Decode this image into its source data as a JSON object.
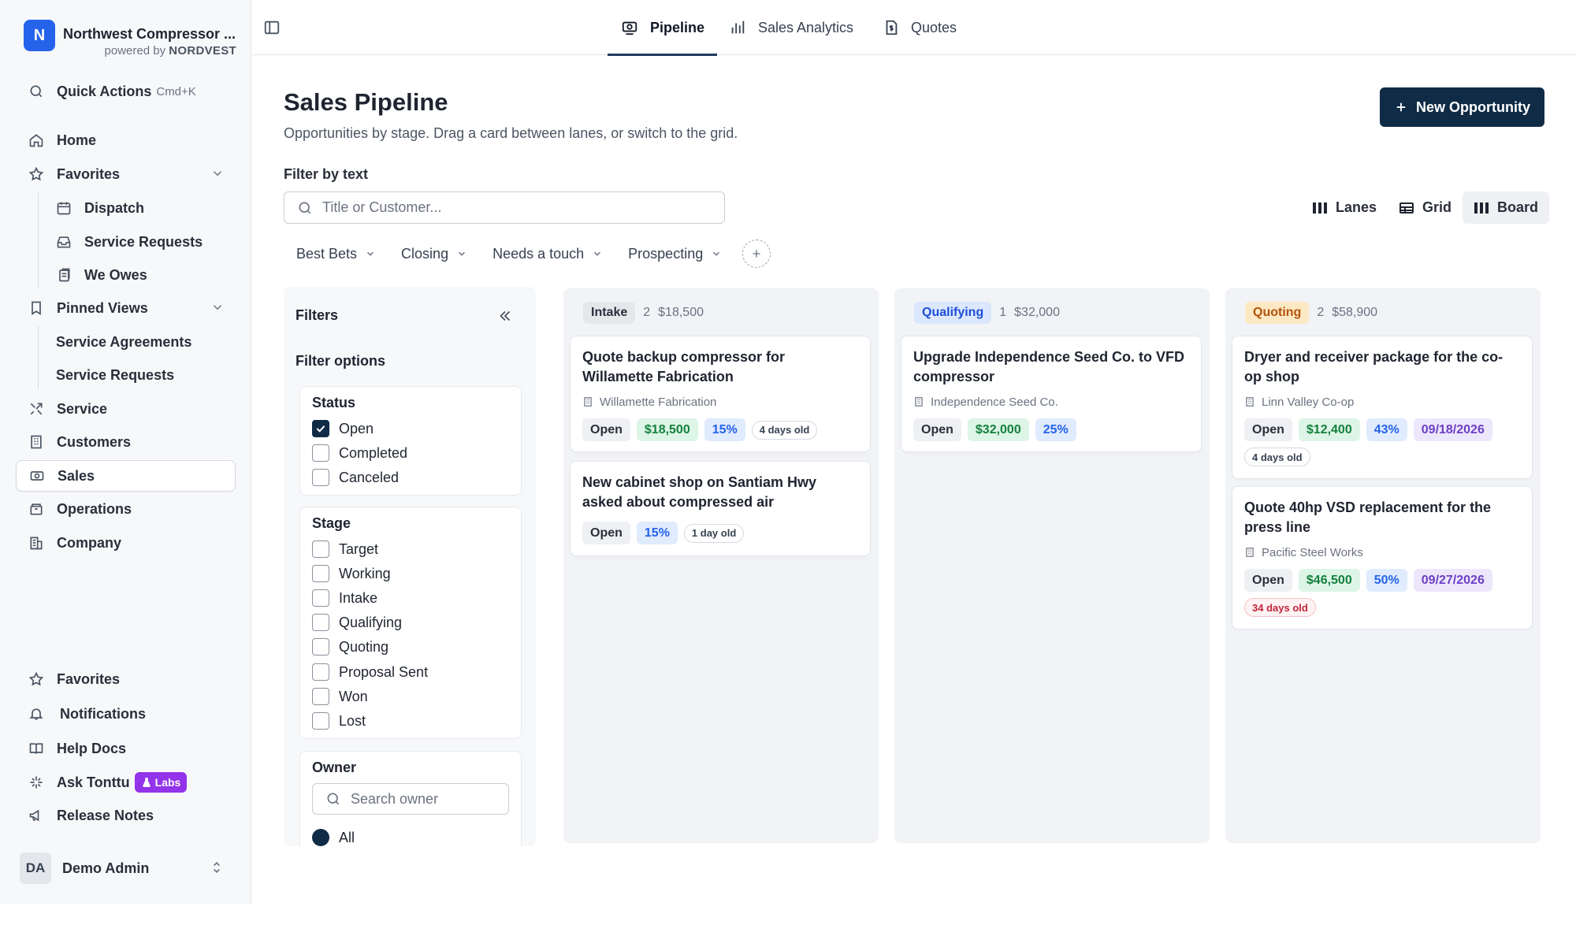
{
  "brand": {
    "logo_letter": "N",
    "name": "Northwest Compressor ...",
    "powered_prefix": "powered by",
    "powered_brand": "NORDVEST"
  },
  "sidebar": {
    "quick_actions": {
      "label": "Quick Actions",
      "shortcut": "Cmd+K",
      "icon": "search-icon"
    },
    "home": {
      "label": "Home",
      "icon": "home-icon"
    },
    "favorites": {
      "label": "Favorites",
      "icon": "star-icon"
    },
    "favorites_items": [
      {
        "label": "Dispatch",
        "icon": "calendar-icon"
      },
      {
        "label": "Service Requests",
        "icon": "inbox-icon"
      },
      {
        "label": "We Owes",
        "icon": "receipts-icon"
      }
    ],
    "pinned_views": {
      "label": "Pinned Views",
      "icon": "bookmark-icon"
    },
    "pinned_items": [
      {
        "label": "Service Agreements"
      },
      {
        "label": "Service Requests"
      }
    ],
    "main_items": [
      {
        "label": "Service",
        "icon": "wrench-icon"
      },
      {
        "label": "Customers",
        "icon": "building-icon"
      },
      {
        "label": "Sales",
        "icon": "sales-icon"
      },
      {
        "label": "Operations",
        "icon": "box-icon"
      },
      {
        "label": "Company",
        "icon": "office-icon"
      }
    ],
    "bottom_items": [
      {
        "label": "Favorites",
        "icon": "star-icon"
      },
      {
        "label": "Notifications",
        "icon": "bell-icon"
      },
      {
        "label": "Help Docs",
        "icon": "book-icon"
      },
      {
        "label": "Ask Tonttu",
        "icon": "sparkle-icon",
        "badge": "Labs"
      },
      {
        "label": "Release Notes",
        "icon": "megaphone-icon"
      }
    ],
    "user": {
      "initials": "DA",
      "name": "Demo Admin"
    }
  },
  "topbar": {
    "tabs": [
      {
        "label": "Pipeline",
        "icon": "pipeline-icon",
        "active": true
      },
      {
        "label": "Sales Analytics",
        "icon": "bar-chart-icon",
        "active": false
      },
      {
        "label": "Quotes",
        "icon": "document-dollar-icon",
        "active": false
      }
    ]
  },
  "header": {
    "title": "Sales Pipeline",
    "subtitle": "Opportunities by stage. Drag a card between lanes, or switch to the grid.",
    "new_button": "New Opportunity",
    "filter_label": "Filter by text",
    "search_placeholder": "Title or Customer...",
    "views": [
      {
        "label": "Lanes"
      },
      {
        "label": "Grid"
      },
      {
        "label": "Board",
        "active": true
      }
    ],
    "saved_filters": [
      {
        "label": "Best Bets"
      },
      {
        "label": "Closing"
      },
      {
        "label": "Needs a touch"
      },
      {
        "label": "Prospecting"
      }
    ]
  },
  "filters": {
    "title": "Filters",
    "options_label": "Filter options",
    "status": {
      "title": "Status",
      "items": [
        {
          "label": "Open",
          "checked": true
        },
        {
          "label": "Completed",
          "checked": false
        },
        {
          "label": "Canceled",
          "checked": false
        }
      ]
    },
    "stage": {
      "title": "Stage",
      "items": [
        {
          "label": "Target"
        },
        {
          "label": "Working"
        },
        {
          "label": "Intake"
        },
        {
          "label": "Qualifying"
        },
        {
          "label": "Quoting"
        },
        {
          "label": "Proposal Sent"
        },
        {
          "label": "Won"
        },
        {
          "label": "Lost"
        }
      ]
    },
    "owner": {
      "title": "Owner",
      "search_placeholder": "Search owner",
      "first_option": "All"
    }
  },
  "colors": {
    "primary": "#0f2b46",
    "brand_blue": "#2563eb",
    "labs_purple": "#9333ea",
    "intake_badge": "#e5e7eb",
    "qualifying_badge": "#dbe7fd",
    "quoting_badge": "#fde8c4",
    "old_age": "#c0263d"
  },
  "lanes": [
    {
      "stage": "Intake",
      "count": "2",
      "amount": "$18,500",
      "cards": [
        {
          "title": "Quote backup compressor for Willamette Fabrication",
          "customer": "Willamette Fabrication",
          "status": "Open",
          "amount": "$18,500",
          "prob": "15%",
          "age": "4 days old"
        },
        {
          "title": "New cabinet shop on Santiam Hwy asked about compressed air",
          "status": "Open",
          "prob": "15%",
          "age": "1 day old"
        }
      ]
    },
    {
      "stage": "Qualifying",
      "count": "1",
      "amount": "$32,000",
      "cards": [
        {
          "title": "Upgrade Independence Seed Co. to VFD compressor",
          "customer": "Independence Seed Co.",
          "status": "Open",
          "amount": "$32,000",
          "prob": "25%"
        }
      ]
    },
    {
      "stage": "Quoting",
      "count": "2",
      "amount": "$58,900",
      "cards": [
        {
          "title": "Dryer and receiver package for the co-op shop",
          "customer": "Linn Valley Co-op",
          "status": "Open",
          "amount": "$12,400",
          "prob": "43%",
          "date": "09/18/2026",
          "age": "4 days old"
        },
        {
          "title": "Quote 40hp VSD replacement for the press line",
          "customer": "Pacific Steel Works",
          "status": "Open",
          "amount": "$46,500",
          "prob": "50%",
          "date": "09/27/2026",
          "age": "34 days old"
        }
      ]
    }
  ]
}
